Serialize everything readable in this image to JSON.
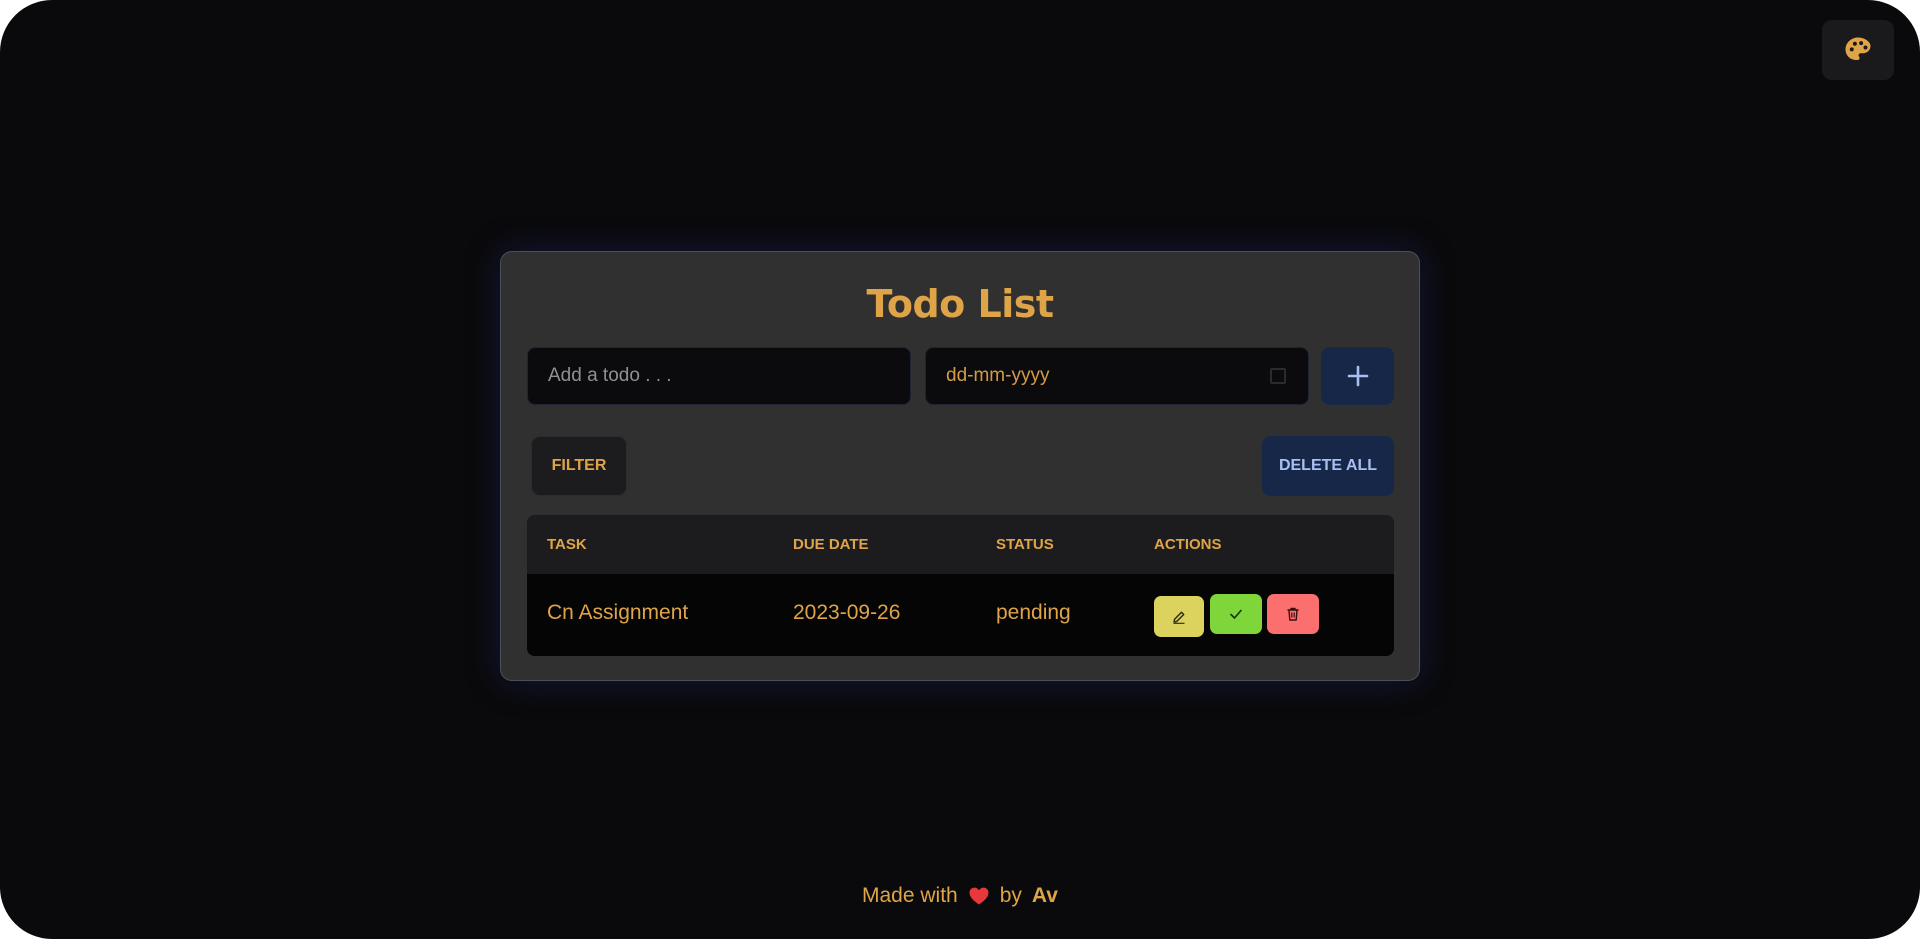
{
  "theme_button": {
    "icon": "palette-icon"
  },
  "card": {
    "title": "Todo List",
    "todo_input": {
      "placeholder": "Add a todo . . ."
    },
    "date_input": {
      "placeholder": "dd-mm-yyyy"
    },
    "add_button": {
      "icon": "plus-icon"
    },
    "filter_label": "FILTER",
    "delete_all_label": "DELETE ALL",
    "table": {
      "headers": [
        "TASK",
        "DUE DATE",
        "STATUS",
        "ACTIONS"
      ],
      "rows": [
        {
          "task": "Cn Assignment",
          "due_date": "2023-09-26",
          "status": "pending"
        }
      ]
    }
  },
  "footer": {
    "prefix": "Made with",
    "heart_icon": "heart-icon",
    "by": "by",
    "author": "Av"
  },
  "colors": {
    "background": "#0a0a0c",
    "card": "#303030",
    "accent": "#e0a448",
    "navy_button": "#172747",
    "edit": "#dcd35e",
    "complete": "#7fd63b",
    "delete": "#fb6f6f"
  }
}
